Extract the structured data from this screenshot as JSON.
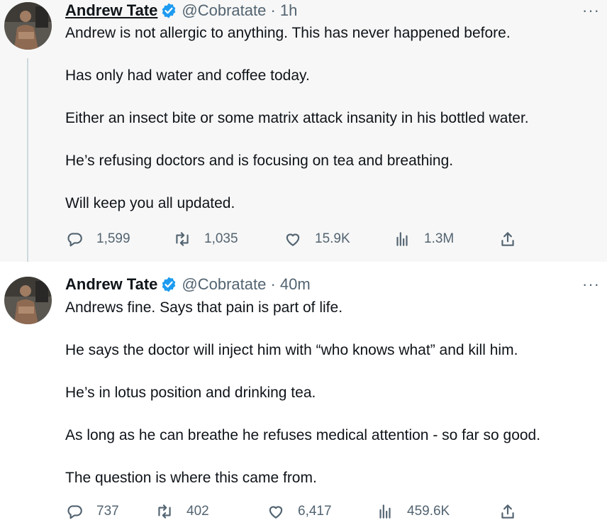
{
  "tweets": [
    {
      "author_name": "Andrew Tate",
      "handle_time": "@Cobratate · 1h",
      "more_label": "···",
      "paragraphs": [
        "Andrew is not allergic to anything. This has never happened before.",
        "Has only had water and coffee today.",
        "Either an insect bite or some matrix attack insanity in his bottled water.",
        "He’s refusing doctors and is focusing on tea and breathing.",
        "Will keep you all updated."
      ],
      "stats": {
        "replies": "1,599",
        "retweets": "1,035",
        "likes": "15.9K",
        "views": "1.3M"
      }
    },
    {
      "author_name": "Andrew Tate",
      "handle_time": "@Cobratate · 40m",
      "more_label": "···",
      "paragraphs": [
        "Andrews fine. Says that pain is part of life.",
        "He says the doctor will inject him with “who knows what” and kill him.",
        "He’s in lotus position and drinking tea.",
        "As long as he can breathe he refuses medical attention - so far so good.",
        "The question is where this came from."
      ],
      "stats": {
        "replies": "737",
        "retweets": "402",
        "likes": "6,417",
        "views": "459.6K"
      }
    }
  ],
  "colors": {
    "verified": "#1d9bf0",
    "muted": "#536471",
    "text": "#0f1419",
    "highlight_bg": "#f7f7f7",
    "thread_line": "#cfd9de"
  },
  "icons": [
    "reply-icon",
    "retweet-icon",
    "like-icon",
    "views-icon",
    "share-icon",
    "verified-badge-icon"
  ]
}
